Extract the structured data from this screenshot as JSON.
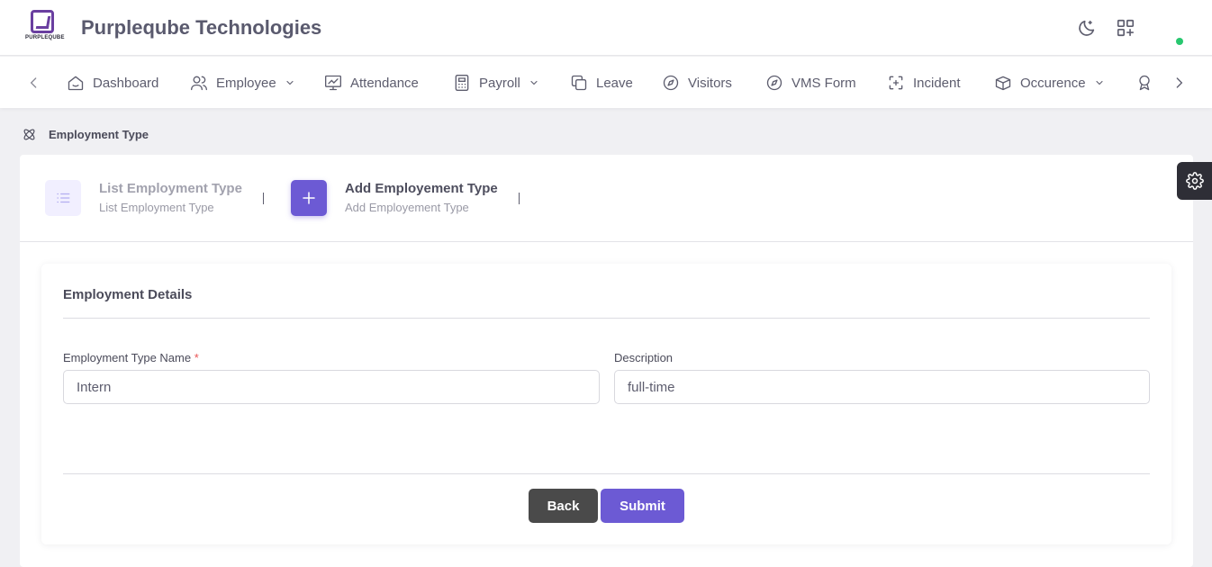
{
  "header": {
    "logo_text": "PURPLEQUBE",
    "company_name": "Purpleqube Technologies"
  },
  "nav": {
    "items": [
      {
        "label": "Dashboard",
        "icon": "home-icon"
      },
      {
        "label": "Employee",
        "icon": "users-icon",
        "has_dropdown": true
      },
      {
        "label": "Attendance",
        "icon": "monitor-chart-icon"
      },
      {
        "label": "Payroll",
        "icon": "calculator-icon",
        "has_dropdown": true
      },
      {
        "label": "Leave",
        "icon": "copy-icon"
      },
      {
        "label": "Visitors",
        "icon": "compass-icon"
      },
      {
        "label": "VMS Form",
        "icon": "compass-icon"
      },
      {
        "label": "Incident",
        "icon": "focus-icon"
      },
      {
        "label": "Occurence",
        "icon": "boxes-icon",
        "has_dropdown": true
      }
    ]
  },
  "breadcrumb": {
    "label": "Employment Type"
  },
  "tabs": [
    {
      "title": "List Employment Type",
      "subtitle": "List Employment Type",
      "icon": "list-icon",
      "active": false
    },
    {
      "title": "Add Employement Type",
      "subtitle": "Add Employement Type",
      "icon": "plus-icon",
      "active": true
    }
  ],
  "form": {
    "section_title": "Employment Details",
    "fields": [
      {
        "label": "Employment Type Name",
        "required_mark": "*",
        "value": "Intern"
      },
      {
        "label": "Description",
        "value": "full-time"
      }
    ],
    "back_label": "Back",
    "submit_label": "Submit"
  },
  "colors": {
    "accent": "#6c5ad4",
    "brand": "#6a3fa0",
    "status_online": "#28c76f",
    "back_button": "#4a4a4a"
  }
}
